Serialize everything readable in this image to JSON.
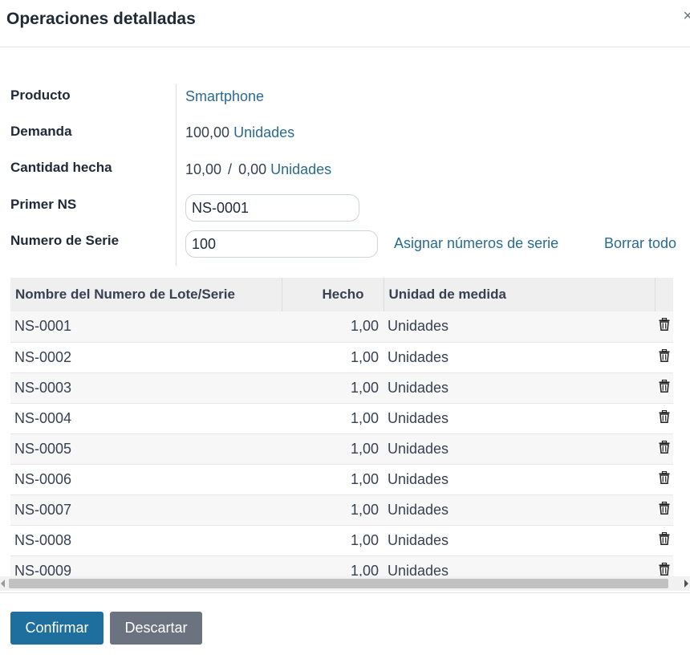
{
  "dialog": {
    "title": "Operaciones detalladas",
    "close": "×"
  },
  "form": {
    "product_label": "Producto",
    "product_value": "Smartphone",
    "demand_label": "Demanda",
    "demand_value": "100,00",
    "demand_uom": "Unidades",
    "done_label": "Cantidad hecha",
    "done_value": "10,00",
    "done_separator": "/",
    "done_total": "0,00",
    "done_uom": "Unidades",
    "first_sn_label": "Primer NS",
    "first_sn_value": "NS-0001",
    "serial_count_label": "Numero de Serie",
    "serial_count_value": "100",
    "assign_link": "Asignar números de serie",
    "clear_link": "Borrar todo"
  },
  "table": {
    "columns": [
      "Nombre del Numero de Lote/Serie",
      "Hecho",
      "Unidad de medida"
    ],
    "rows": [
      {
        "name": "NS-0001",
        "done": "1,00",
        "uom": "Unidades"
      },
      {
        "name": "NS-0002",
        "done": "1,00",
        "uom": "Unidades"
      },
      {
        "name": "NS-0003",
        "done": "1,00",
        "uom": "Unidades"
      },
      {
        "name": "NS-0004",
        "done": "1,00",
        "uom": "Unidades"
      },
      {
        "name": "NS-0005",
        "done": "1,00",
        "uom": "Unidades"
      },
      {
        "name": "NS-0006",
        "done": "1,00",
        "uom": "Unidades"
      },
      {
        "name": "NS-0007",
        "done": "1,00",
        "uom": "Unidades"
      },
      {
        "name": "NS-0008",
        "done": "1,00",
        "uom": "Unidades"
      },
      {
        "name": "NS-0009",
        "done": "1,00",
        "uom": "Unidades"
      }
    ]
  },
  "footer": {
    "confirm_label": "Confirmar",
    "discard_label": "Descartar"
  },
  "icons": {
    "close": "close-icon",
    "row_delete": "trash-icon",
    "scroll_left": "chevron-left-icon",
    "scroll_right": "chevron-right-icon"
  },
  "colors": {
    "link": "#2a6a93",
    "primary_button": "#1f6f9e",
    "secondary_button": "#6b7380",
    "header_bg": "#efefef"
  }
}
